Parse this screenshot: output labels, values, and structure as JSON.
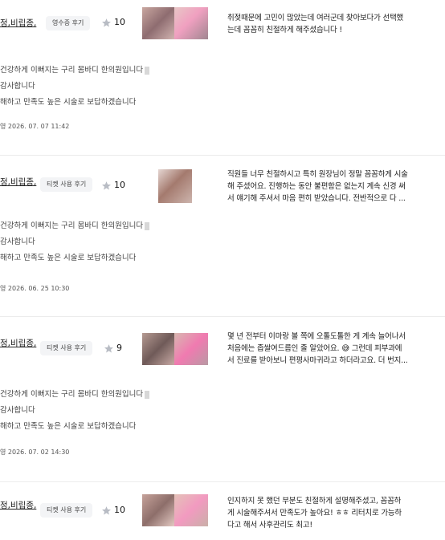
{
  "reviews": [
    {
      "title": "정,비립종,",
      "badge": "영수증 후기",
      "score": "10",
      "review_lines": [
        "취젖때문에 고민이 많았는데 여러군데 찾아보다가 선택했",
        "는데 꼼꼼히 친절하게 해주셨습니다 !"
      ],
      "reply_lines": [
        "건강하게 이뻐지는 구리 몸바디 한의원입니다",
        "감사합니다",
        "해하고 만족도 높은 시술로 보답하겠습니다"
      ],
      "timestamp": "영 2026. 07. 07 11:42"
    },
    {
      "title": "정,비립종,",
      "badge": "티켓 사용 후기",
      "score": "10",
      "review_lines": [
        "직원들 너무 친절하시고 특히 원장님이 정말 꼼꼼하게 시술",
        "해 주셨어요. 진행하는 동안 불편함은 없는지 계속 신경 써",
        "서 얘기해 주셔서 마음 편히 받았습니다. 전반적으로 다 ..."
      ],
      "reply_lines": [
        "건강하게 이뻐지는 구리 몸바디 한의원입니다",
        "감사합니다",
        "해하고 만족도 높은 시술로 보답하겠습니다"
      ],
      "timestamp": "영 2026. 06. 25 10:30"
    },
    {
      "title": "정,비립종,",
      "badge": "티켓 사용 후기",
      "score": "9",
      "review_lines": [
        "몇 년 전부터 이마랑 볼 쪽에 오톨도톨한 게 계속 늘어나서",
        "처음에는 좁쌀여드름인 줄 알았어요. 😅 그런데 피부과에",
        "서 진료를 받아보니 편평사마귀라고 하더라고요. 더 번지..."
      ],
      "reply_lines": [
        "건강하게 이뻐지는 구리 몸바디 한의원입니다",
        "감사합니다",
        "해하고 만족도 높은 시술로 보답하겠습니다"
      ],
      "timestamp": "영 2026. 07. 02 14:30"
    },
    {
      "title": "정,비립종,",
      "badge": "티켓 사용 후기",
      "score": "10",
      "review_lines": [
        "인지하지 못 했던 부분도 친절하게 설명해주셨고, 꼼꼼하",
        "게 시술해주셔서 만족도가 높아요! ㅎㅎ 리터치로 가능하",
        "다고 해서 사후관리도 최고!"
      ],
      "reply_lines": [],
      "timestamp": ""
    }
  ],
  "icons": {
    "star": "star-icon",
    "star_color": "#b8bcc4"
  }
}
